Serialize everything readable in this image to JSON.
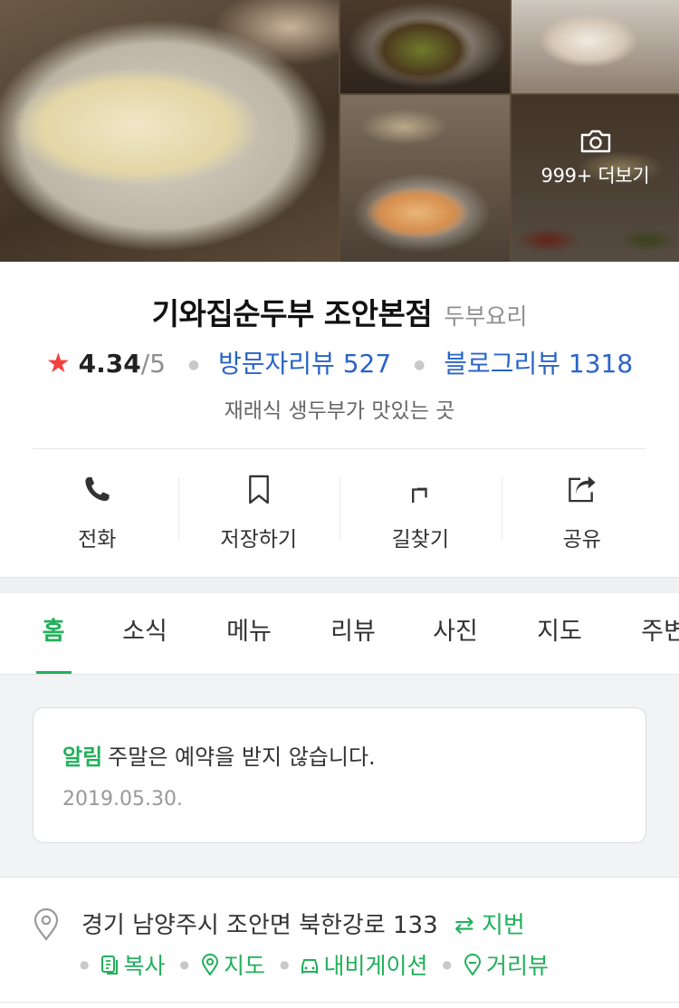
{
  "gallery": {
    "more_label": "999+ 더보기"
  },
  "place": {
    "name": "기와집순두부 조안본점",
    "category": "두부요리",
    "rating": "4.34",
    "rating_max": "/5",
    "visitor_reviews": "방문자리뷰 527",
    "blog_reviews": "블로그리뷰 1318",
    "description": "재래식 생두부가 맛있는 곳"
  },
  "actions": [
    {
      "label": "전화",
      "icon": "phone-icon"
    },
    {
      "label": "저장하기",
      "icon": "bookmark-icon"
    },
    {
      "label": "길찾기",
      "icon": "directions-icon"
    },
    {
      "label": "공유",
      "icon": "share-icon"
    }
  ],
  "tabs": [
    {
      "label": "홈",
      "active": true
    },
    {
      "label": "소식"
    },
    {
      "label": "메뉴"
    },
    {
      "label": "리뷰"
    },
    {
      "label": "사진"
    },
    {
      "label": "지도"
    },
    {
      "label": "주변"
    }
  ],
  "notice": {
    "label": "알림",
    "text": "주말은 예약을 받지 않습니다.",
    "date": "2019.05.30."
  },
  "address": {
    "text": "경기 남양주시 조안면 북한강로 133",
    "jibun_label": "지번",
    "copy_label": "복사",
    "map_label": "지도",
    "navigation_label": "내비게이션",
    "streetview_label": "거리뷰"
  },
  "colors": {
    "accent_green": "#20b05a",
    "link_blue": "#2a64c8",
    "star_red": "#f1413e"
  }
}
